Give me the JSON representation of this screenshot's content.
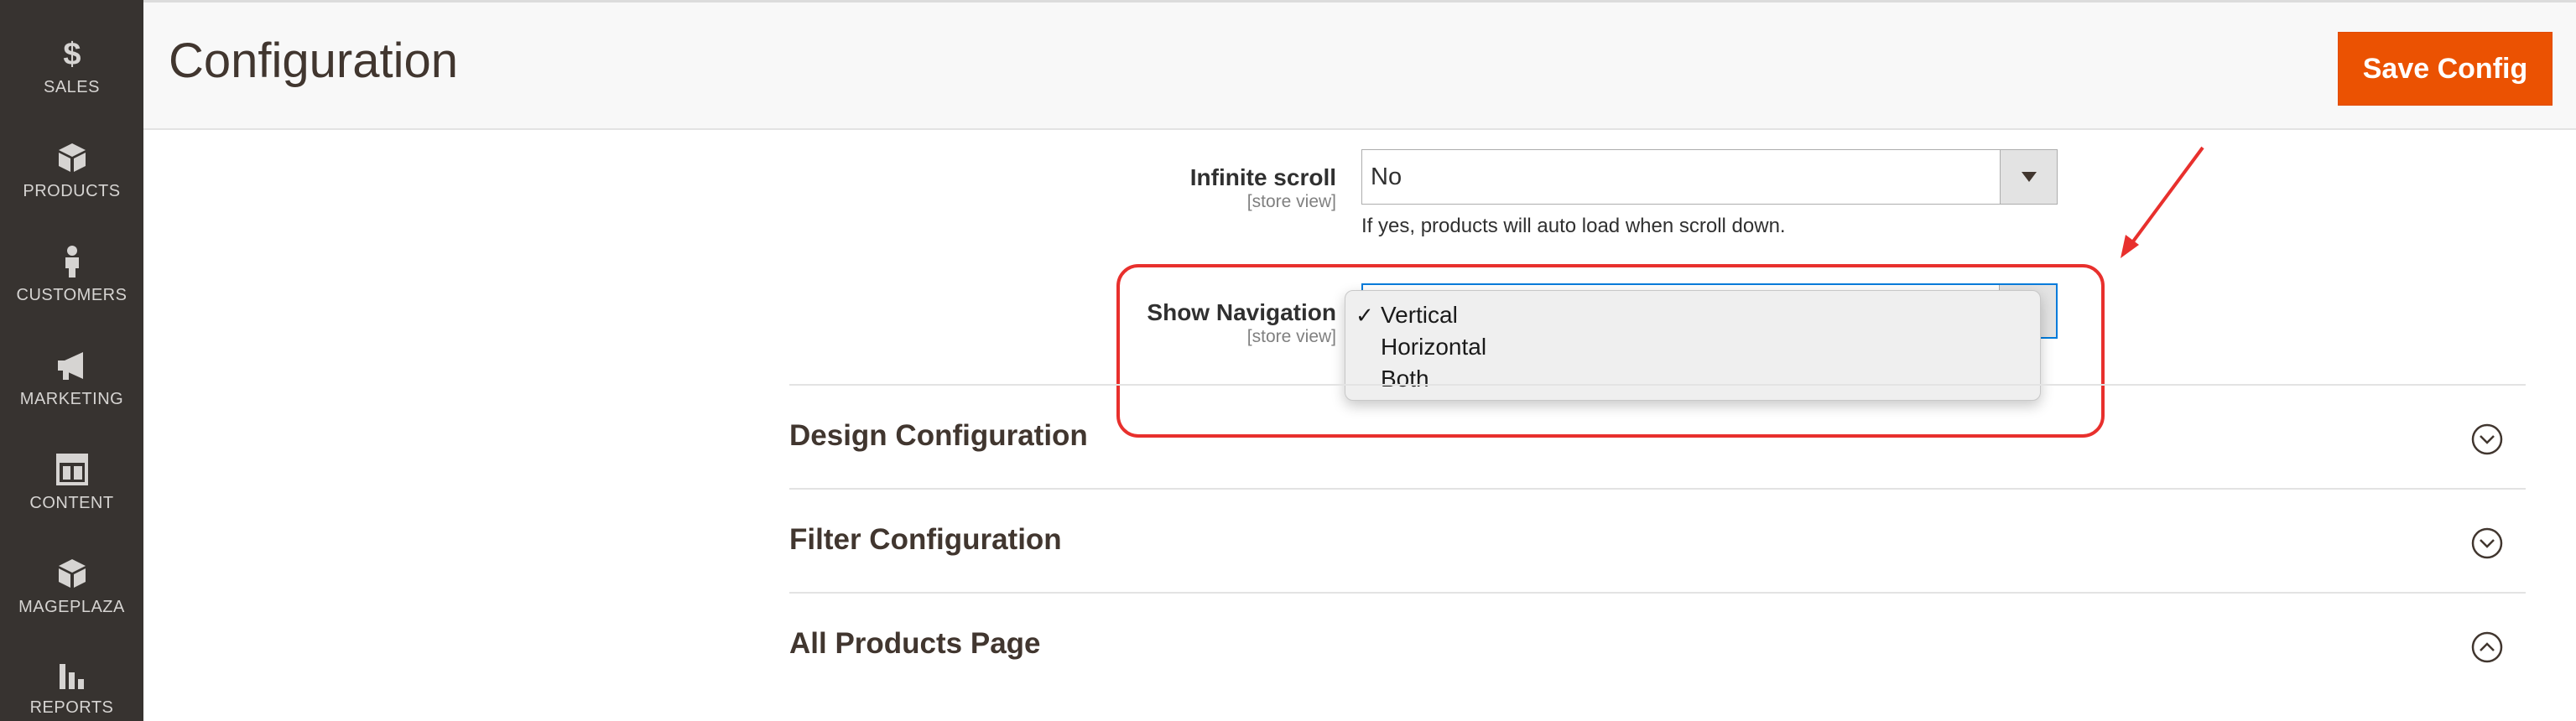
{
  "sidebar": {
    "items": [
      {
        "label": "SALES",
        "icon": "dollar-icon"
      },
      {
        "label": "PRODUCTS",
        "icon": "cube-icon"
      },
      {
        "label": "CUSTOMERS",
        "icon": "person-icon"
      },
      {
        "label": "MARKETING",
        "icon": "megaphone-icon"
      },
      {
        "label": "CONTENT",
        "icon": "layout-icon"
      },
      {
        "label": "MAGEPLAZA",
        "icon": "cube-icon"
      },
      {
        "label": "REPORTS",
        "icon": "bar-chart-icon"
      }
    ]
  },
  "header": {
    "title": "Configuration",
    "save_label": "Save Config"
  },
  "fields": {
    "infinite_scroll": {
      "label": "Infinite scroll",
      "scope": "[store view]",
      "value": "No",
      "note": "If yes, products will auto load when scroll down."
    },
    "show_navigation": {
      "label": "Show Navigation",
      "scope": "[store view]",
      "check": "✓",
      "options": [
        "Vertical",
        "Horizontal",
        "Both"
      ],
      "selected": "Vertical"
    }
  },
  "sections": [
    {
      "title": "Design Configuration",
      "state": "collapsed"
    },
    {
      "title": "Filter Configuration",
      "state": "collapsed"
    },
    {
      "title": "All Products Page",
      "state": "expanded"
    }
  ],
  "colors": {
    "accent": "#eb5202",
    "sidebar": "#373330",
    "annotation": "#e8302d",
    "focus": "#007bdb"
  }
}
